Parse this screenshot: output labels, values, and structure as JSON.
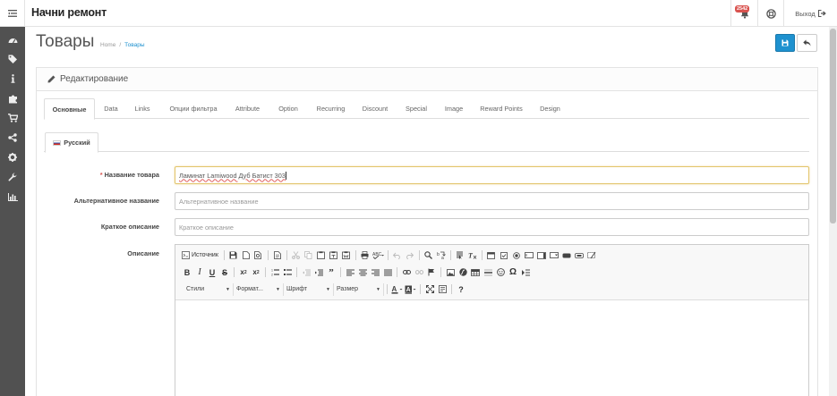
{
  "app": {
    "brand": "Начни ремонт"
  },
  "header": {
    "notifications_count": "2542",
    "logout_label": "Выход"
  },
  "sidebar": {
    "icons": [
      "dashboard-icon",
      "tags-icon",
      "info-icon",
      "puzzle-icon",
      "cart-icon",
      "share-icon",
      "gear-icon",
      "wrench-icon",
      "bar-chart-icon"
    ]
  },
  "page": {
    "title": "Товары",
    "breadcrumb": [
      "Home",
      "Товары"
    ]
  },
  "panel": {
    "heading": "Редактирование"
  },
  "tabs": [
    "Основные",
    "Data",
    "Links",
    "Опции фильтра",
    "Attribute",
    "Option",
    "Recurring",
    "Discount",
    "Special",
    "Image",
    "Reward Points",
    "Design"
  ],
  "language_tab": "Русский",
  "form": {
    "name_label": "Название товара",
    "name_value": "Ламинат Lamiwood Дуб Батист 303",
    "alt_label": "Альтернативное название",
    "alt_placeholder": "Альтернативное название",
    "short_label": "Краткое описание",
    "short_placeholder": "Краткое описание",
    "desc_label": "Описание"
  },
  "editor": {
    "source_label": "Источник",
    "styles_label": "Стили",
    "format_label": "Формат...",
    "font_label": "Шрифт",
    "size_label": "Размер"
  },
  "colors": {
    "primary": "#1e91cf",
    "sidebar": "#515151",
    "required": "#d9534f"
  }
}
